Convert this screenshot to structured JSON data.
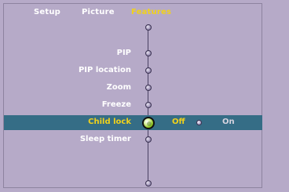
{
  "tabs": [
    {
      "label": "Setup",
      "active": false
    },
    {
      "label": "Picture",
      "active": false
    },
    {
      "label": "Features",
      "active": true
    }
  ],
  "menu": {
    "items": [
      {
        "label": "PIP",
        "selected": false
      },
      {
        "label": "PIP location",
        "selected": false
      },
      {
        "label": "Zoom",
        "selected": false
      },
      {
        "label": "Freeze",
        "selected": false
      },
      {
        "label": "Child lock",
        "selected": true
      },
      {
        "label": "Sleep timer",
        "selected": false
      }
    ]
  },
  "child_lock": {
    "options": [
      {
        "label": "Off",
        "selected": true
      },
      {
        "label": "On",
        "selected": false
      }
    ]
  },
  "colors": {
    "background": "#b6aac8",
    "highlight": "#356d86",
    "active_text": "#f1d21b",
    "text": "#ffffff"
  },
  "icons": {
    "menu_node": "menu-node-icon",
    "selected_node": "selected-node-icon",
    "option_knob": "option-knob-icon"
  }
}
